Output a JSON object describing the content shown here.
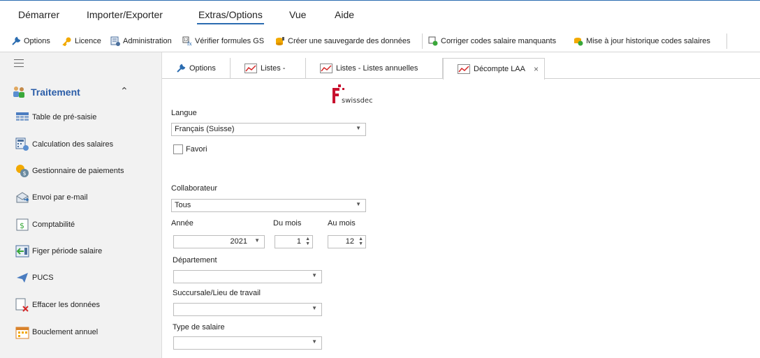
{
  "menu": {
    "items": [
      "Démarrer",
      "Importer/Exporter",
      "Extras/Options",
      "Vue",
      "Aide"
    ],
    "active": "Extras/Options"
  },
  "toolbar": {
    "options": "Options",
    "licence": "Licence",
    "administration": "Administration",
    "verifier": "Vérifier formules GS",
    "sauvegarde": "Créer une sauvegarde des données",
    "corriger": "Corriger codes salaire manquants",
    "historique": "Mise à jour historique codes salaires"
  },
  "sidebar": {
    "section": "Traitement",
    "items": [
      {
        "label": "Table de pré-saisie",
        "icon": "table-icon"
      },
      {
        "label": "Calculation des salaires",
        "icon": "calculator-icon"
      },
      {
        "label": "Gestionnaire de paiements",
        "icon": "coins-icon"
      },
      {
        "label": "Envoi par e-mail",
        "icon": "email-icon"
      },
      {
        "label": "Comptabilité",
        "icon": "dollar-icon"
      },
      {
        "label": "Figer période salaire",
        "icon": "freeze-period-icon"
      },
      {
        "label": "PUCS",
        "icon": "send-plane-icon"
      },
      {
        "label": "Effacer les données",
        "icon": "delete-data-icon"
      },
      {
        "label": "Bouclement annuel",
        "icon": "calendar-icon"
      }
    ]
  },
  "tabs": [
    {
      "label": "Options",
      "icon": "wrench-icon"
    },
    {
      "label": "Listes -",
      "icon": "chart-icon"
    },
    {
      "label": "Listes - Listes annuelles",
      "icon": "chart-icon"
    },
    {
      "label": "Décompte LAA",
      "icon": "chart-icon",
      "active": true
    }
  ],
  "tab_close": "×",
  "form": {
    "logo_text": "swissdec",
    "langue_label": "Langue",
    "langue_value": "Français (Suisse)",
    "favori_label": "Favori",
    "collaborateur_label": "Collaborateur",
    "collaborateur_value": "Tous",
    "annee_label": "Année",
    "annee_value": "2021",
    "du_mois_label": "Du mois",
    "du_mois_value": "1",
    "au_mois_label": "Au mois",
    "au_mois_value": "12",
    "departement_label": "Département",
    "departement_value": "",
    "succursale_label": "Succursale/Lieu de travail",
    "succursale_value": "",
    "type_salaire_label": "Type de salaire",
    "type_salaire_value": ""
  },
  "colors": {
    "accent": "#2b6cb0",
    "section_title": "#2b5da8",
    "sidebar_bg": "#f2f2f2",
    "logo_red": "#c8102e"
  }
}
